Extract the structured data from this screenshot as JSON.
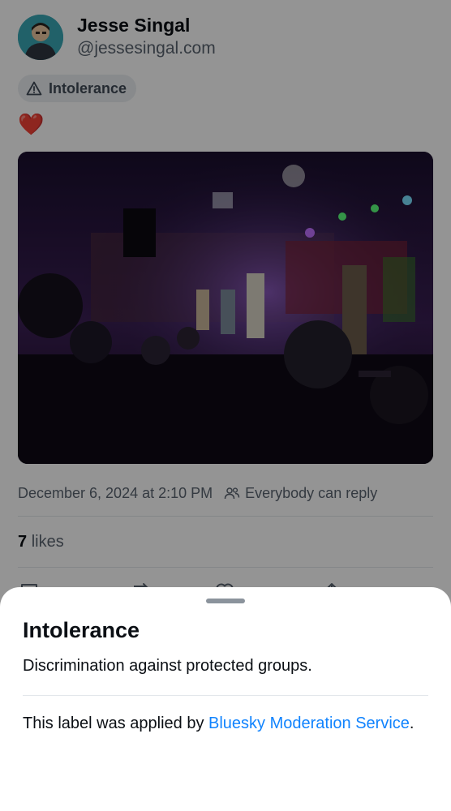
{
  "post": {
    "author_name": "Jesse Singal",
    "author_handle": "@jessesingal.com",
    "label_chip": "Intolerance",
    "text": "❤️",
    "date": "December 6, 2024 at 2:10 PM",
    "reply_setting": "Everybody can reply",
    "likes_count": "7",
    "likes_label": "likes"
  },
  "sheet": {
    "title": "Intolerance",
    "description": "Discrimination against protected groups.",
    "source_prefix": "This label was applied by ",
    "source_link": "Bluesky Moderation Service",
    "source_suffix": "."
  },
  "colors": {
    "link": "#1083fe",
    "overlay": "rgba(0,0,0,0.42)",
    "heart": "#e0245e"
  },
  "icons": {
    "label_chip": "warning-triangle-icon",
    "reply_setting": "people-icon",
    "actions": [
      "reply-icon",
      "repost-icon",
      "like-icon",
      "share-icon"
    ]
  }
}
